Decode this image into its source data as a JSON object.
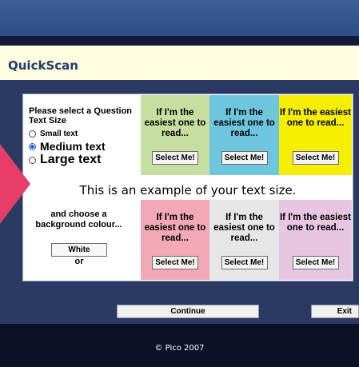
{
  "header": {
    "title": "QuickScan"
  },
  "text_size": {
    "heading": "Please select a Question Text Size",
    "options": [
      {
        "label": "Small text",
        "checked": false
      },
      {
        "label": "Medium text",
        "checked": true
      },
      {
        "label": "Large text",
        "checked": false
      }
    ]
  },
  "sample": {
    "text": "If I'm the easiest one to read...",
    "button_label": "Select Me!"
  },
  "swatches": [
    {
      "color": "#c6dea0"
    },
    {
      "color": "#6ec6de"
    },
    {
      "color": "#f6ee00"
    },
    {
      "color": "#f2a8b6"
    },
    {
      "color": "#e6e6e6"
    },
    {
      "color": "#e8c6e2"
    }
  ],
  "example": "This is an example of your text size.",
  "background": {
    "heading": "and choose a background colour...",
    "white_label": "White",
    "or_label": "or"
  },
  "actions": {
    "continue_label": "Continue",
    "exit_label": "Exit"
  },
  "footer": {
    "copyright": "© Pico 2007"
  }
}
